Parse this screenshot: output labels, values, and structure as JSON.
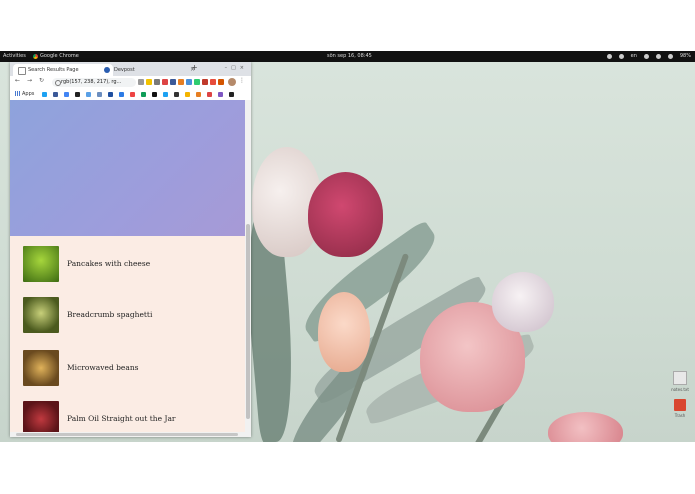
{
  "topbar": {
    "activities": "Activities",
    "app_name": "Google Chrome",
    "clock": "sön sep 16, 08:45",
    "language": "en",
    "battery": "98%"
  },
  "browser": {
    "tabs": [
      {
        "title": "Search Results Page",
        "active": true
      },
      {
        "title": "Devpost",
        "active": false
      }
    ],
    "address": "rgb(157, 238, 217), rg...",
    "bookmarks_apps_label": "Apps"
  },
  "results": {
    "items": [
      {
        "label": "Pancakes with cheese"
      },
      {
        "label": "Breadcrumb spaghetti"
      },
      {
        "label": "Microwaved beans"
      },
      {
        "label": "Palm Oil Straight out the Jar"
      }
    ]
  },
  "desktop_icons": {
    "file_label": "notes.txt",
    "trash_label": "Trash"
  },
  "colors": {
    "hero_gradient_start": "#8ea3dc",
    "hero_gradient_end": "#a79ad6",
    "results_bg": "#fbece4",
    "desktop_bg": "#d9e4dc"
  }
}
